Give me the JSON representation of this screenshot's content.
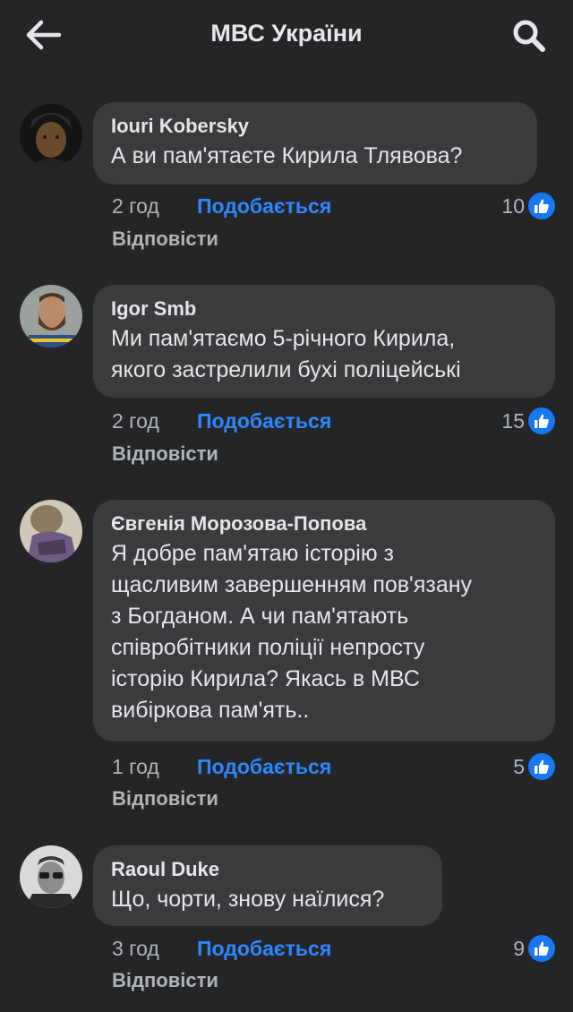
{
  "header": {
    "title": "МВС України",
    "back_icon": "arrow-left-icon",
    "search_icon": "search-icon"
  },
  "colors": {
    "background": "#242526",
    "bubble": "#3a3b3c",
    "accent": "#2d88ff",
    "like_badge": "#1877f2",
    "secondary_text": "#b0b3b8"
  },
  "actions": {
    "like_label": "Подобається",
    "reply_label": "Відповісти"
  },
  "comments": [
    {
      "author": "Iouri Kobersky",
      "lines": [
        "А ви пам'ятаєте Кирила Тлявова?"
      ],
      "time": "2 год",
      "likes": "10"
    },
    {
      "author": "Igor Smb",
      "lines": [
        "Ми пам'ятаємо 5-річного Кирила,",
        "якого застрелили бухі поліцейські"
      ],
      "time": "2 год",
      "likes": "15"
    },
    {
      "author": "Євгенія Морозова-Попова",
      "lines": [
        "Я добре пам'ятаю історію з",
        "щасливим завершенням пов'язану",
        "з Богданом. А чи пам'ятають",
        "співробітники поліції непросту",
        "історію Кирила? Якась в МВС",
        "вибіркова пам'ять.."
      ],
      "time": "1 год",
      "likes": "5"
    },
    {
      "author": "Raoul Duke",
      "lines": [
        "Що, чорти, знову наїлися?"
      ],
      "time": "3 год",
      "likes": "9"
    }
  ]
}
